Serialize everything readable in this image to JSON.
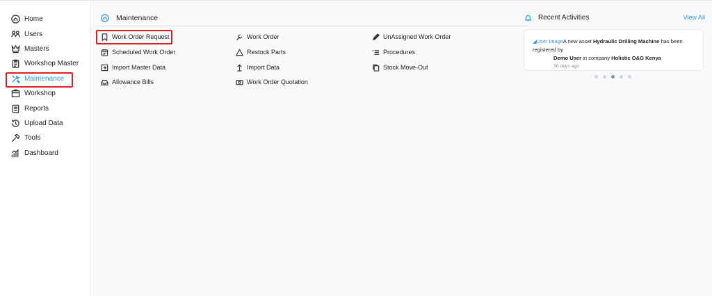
{
  "sidebar": {
    "items": [
      {
        "label": "Home",
        "icon": "home-icon"
      },
      {
        "label": "Users",
        "icon": "users-icon"
      },
      {
        "label": "Masters",
        "icon": "crown-icon"
      },
      {
        "label": "Workshop Master",
        "icon": "clipboard-icon"
      },
      {
        "label": "Maintenance",
        "icon": "tools-icon",
        "active": true
      },
      {
        "label": "Workshop",
        "icon": "workshop-icon"
      },
      {
        "label": "Reports",
        "icon": "report-icon"
      },
      {
        "label": "Upload Data",
        "icon": "history-icon"
      },
      {
        "label": "Tools",
        "icon": "hammer-icon"
      },
      {
        "label": "Dashboard",
        "icon": "chart-icon"
      }
    ]
  },
  "section": {
    "title": "Maintenance",
    "icon": "home-icon"
  },
  "menu": {
    "work_order_request": "Work Order Request",
    "scheduled_work_order": "Scheduled Work Order",
    "import_master_data": "Import Master Data",
    "allowance_bills": "Allowance Bills",
    "work_order": "Work Order",
    "restock_parts": "Restock Parts",
    "import_data": "Import Data",
    "work_order_quotation": "Work Order Quotation",
    "unassigned_work_order": "UnAssigned Work Order",
    "procedures": "Procedures",
    "stock_move_out": "Stock Move-Out"
  },
  "activities": {
    "title": "Recent Activities",
    "view_all": "View All",
    "item": {
      "img_alt": "User Image",
      "text_1": "A new asset ",
      "asset": "Hydraulic Drilling Machine",
      "text_2": " has been registered by",
      "user": "Demo User",
      "text_3": " in company ",
      "company": "Holistic O&G Kenya",
      "time": "30 days ago"
    },
    "carousel_active_index": 2
  },
  "colors": {
    "accent": "#2a9bd6",
    "highlight": "#e02020"
  }
}
